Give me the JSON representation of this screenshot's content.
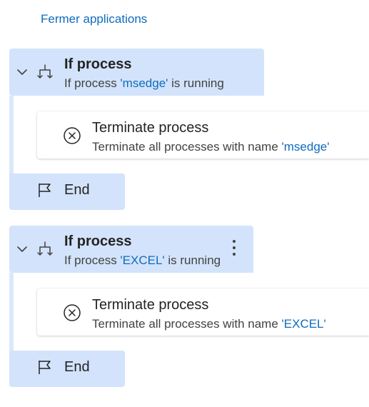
{
  "top_link": "Fermer applications",
  "blocks": [
    {
      "if_title": "If process",
      "if_sub_prefix": "If process ",
      "if_process": "'msedge'",
      "if_sub_suffix": " is running",
      "action_title": "Terminate process",
      "action_sub_prefix": "Terminate all processes with name ",
      "action_process": "'msedge'",
      "end_label": "End"
    },
    {
      "if_title": "If process",
      "if_sub_prefix": "If process ",
      "if_process": "'EXCEL'",
      "if_sub_suffix": " is running",
      "action_title": "Terminate process",
      "action_sub_prefix": "Terminate all processes with name ",
      "action_process": "'EXCEL'",
      "end_label": "End"
    }
  ],
  "colors": {
    "accent": "#0f6cbd",
    "block_bg": "#d3e3fb",
    "rail": "#dbe8fb"
  },
  "icons": {
    "collapse": "chevron-down-icon",
    "if": "branch-icon",
    "action": "close-circle-icon",
    "end": "flag-icon",
    "menu": "more-vertical-icon"
  }
}
